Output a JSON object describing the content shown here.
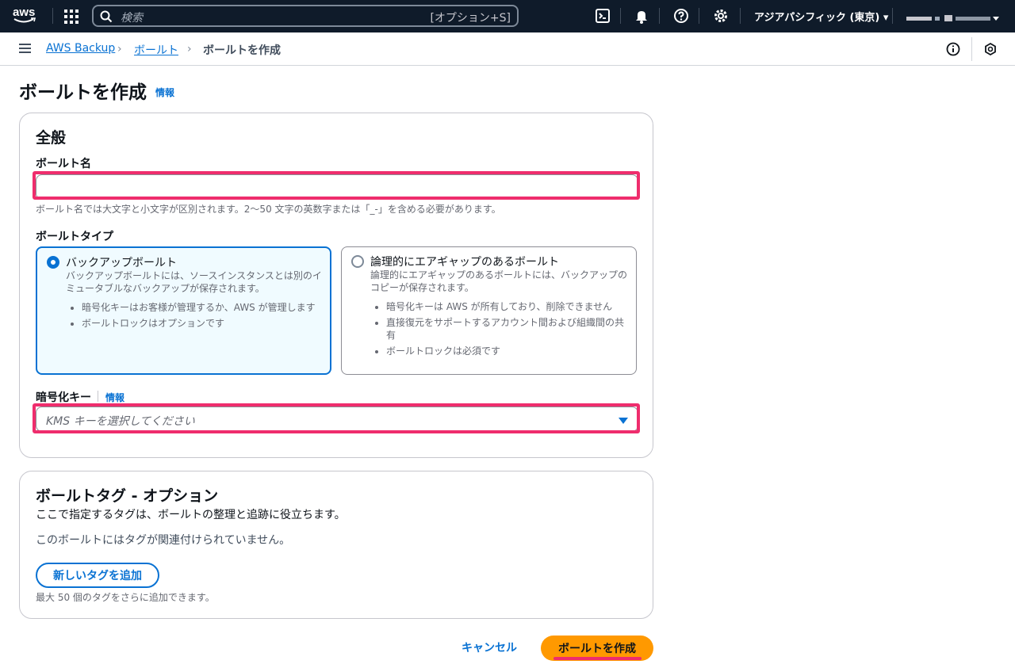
{
  "topnav": {
    "logo": "aws",
    "search_placeholder": "検索",
    "search_shortcut": "[オプション+S]",
    "icons": [
      "grid-icon",
      "search-icon",
      "cloudshell-icon",
      "bell-icon",
      "help-icon",
      "gear-icon"
    ],
    "region": "アジアパシフィック (東京) ▾"
  },
  "breadcrumb": {
    "items": [
      "AWS Backup",
      "ボールト",
      "ボールトを作成"
    ]
  },
  "page": {
    "title": "ボールトを作成",
    "info": "情報"
  },
  "general": {
    "title": "全般",
    "vault_name_label": "ボールト名",
    "vault_name_value": "",
    "vault_name_constraint": "ボールト名では大文字と小文字が区別されます。2〜50 文字の英数字または「_-」を含める必要があります。",
    "vault_type_label": "ボールトタイプ",
    "vault_types": [
      {
        "title": "バックアップボールト",
        "description": "バックアップボールトには、ソースインスタンスとは別のイミュータブルなバックアップが保存されます。",
        "bullets": [
          "暗号化キーはお客様が管理するか、AWS が管理します",
          "ボールトロックはオプションです"
        ],
        "selected": true
      },
      {
        "title": "論理的にエアギャップのあるボールト",
        "description": "論理的にエアギャップのあるボールトには、バックアップのコピーが保存されます。",
        "bullets": [
          "暗号化キーは AWS が所有しており、削除できません",
          "直接復元をサポートするアカウント間および組織間の共有",
          "ボールトロックは必須です"
        ],
        "selected": false
      }
    ],
    "encryption_label": "暗号化キー",
    "encryption_info": "情報",
    "encryption_placeholder": "KMS キーを選択してください"
  },
  "tags": {
    "title": "ボールトタグ - オプション",
    "description": "ここで指定するタグは、ボールトの整理と追跡に役立ちます。",
    "empty_text": "このボールトにはタグが関連付けられていません。",
    "add_button": "新しいタグを追加",
    "limit_text": "最大 50 個のタグをさらに追加できます。"
  },
  "actions": {
    "cancel": "キャンセル",
    "create": "ボールトを作成"
  },
  "colors": {
    "nav_bg": "#0f1b2a",
    "link": "#0972d3",
    "primary": "#ff9900",
    "highlight": "#ef2d6d"
  }
}
